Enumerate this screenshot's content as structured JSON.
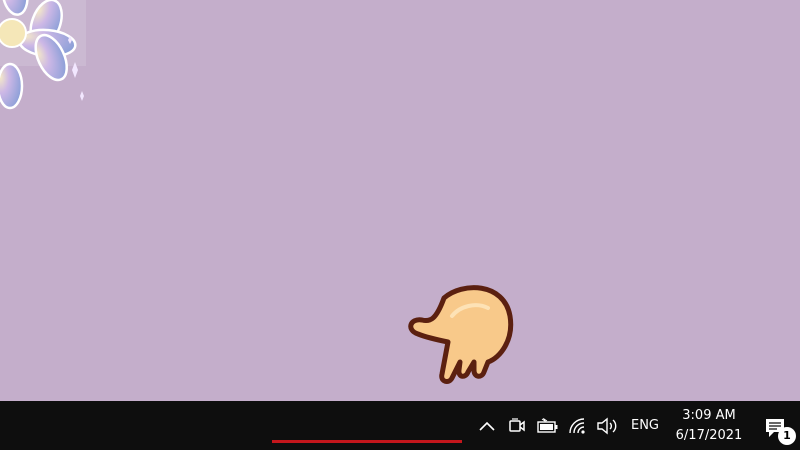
{
  "desktop": {
    "background_color": "#c4aecb",
    "wallpaper_icon": "flower-icon",
    "cursor_icon": "pointing-hand-icon"
  },
  "taskbar": {
    "background_color": "#0e0e0e",
    "tray": {
      "icons": [
        "chevron-up-icon",
        "meet-now-icon",
        "battery-icon",
        "wifi-icon",
        "volume-icon"
      ],
      "language": "ENG"
    },
    "clock": {
      "time": "3:09 AM",
      "date": "6/17/2021"
    },
    "action_center": {
      "icon": "notification-icon",
      "badge_count": "1"
    },
    "indicator_color": "#c4161c"
  }
}
